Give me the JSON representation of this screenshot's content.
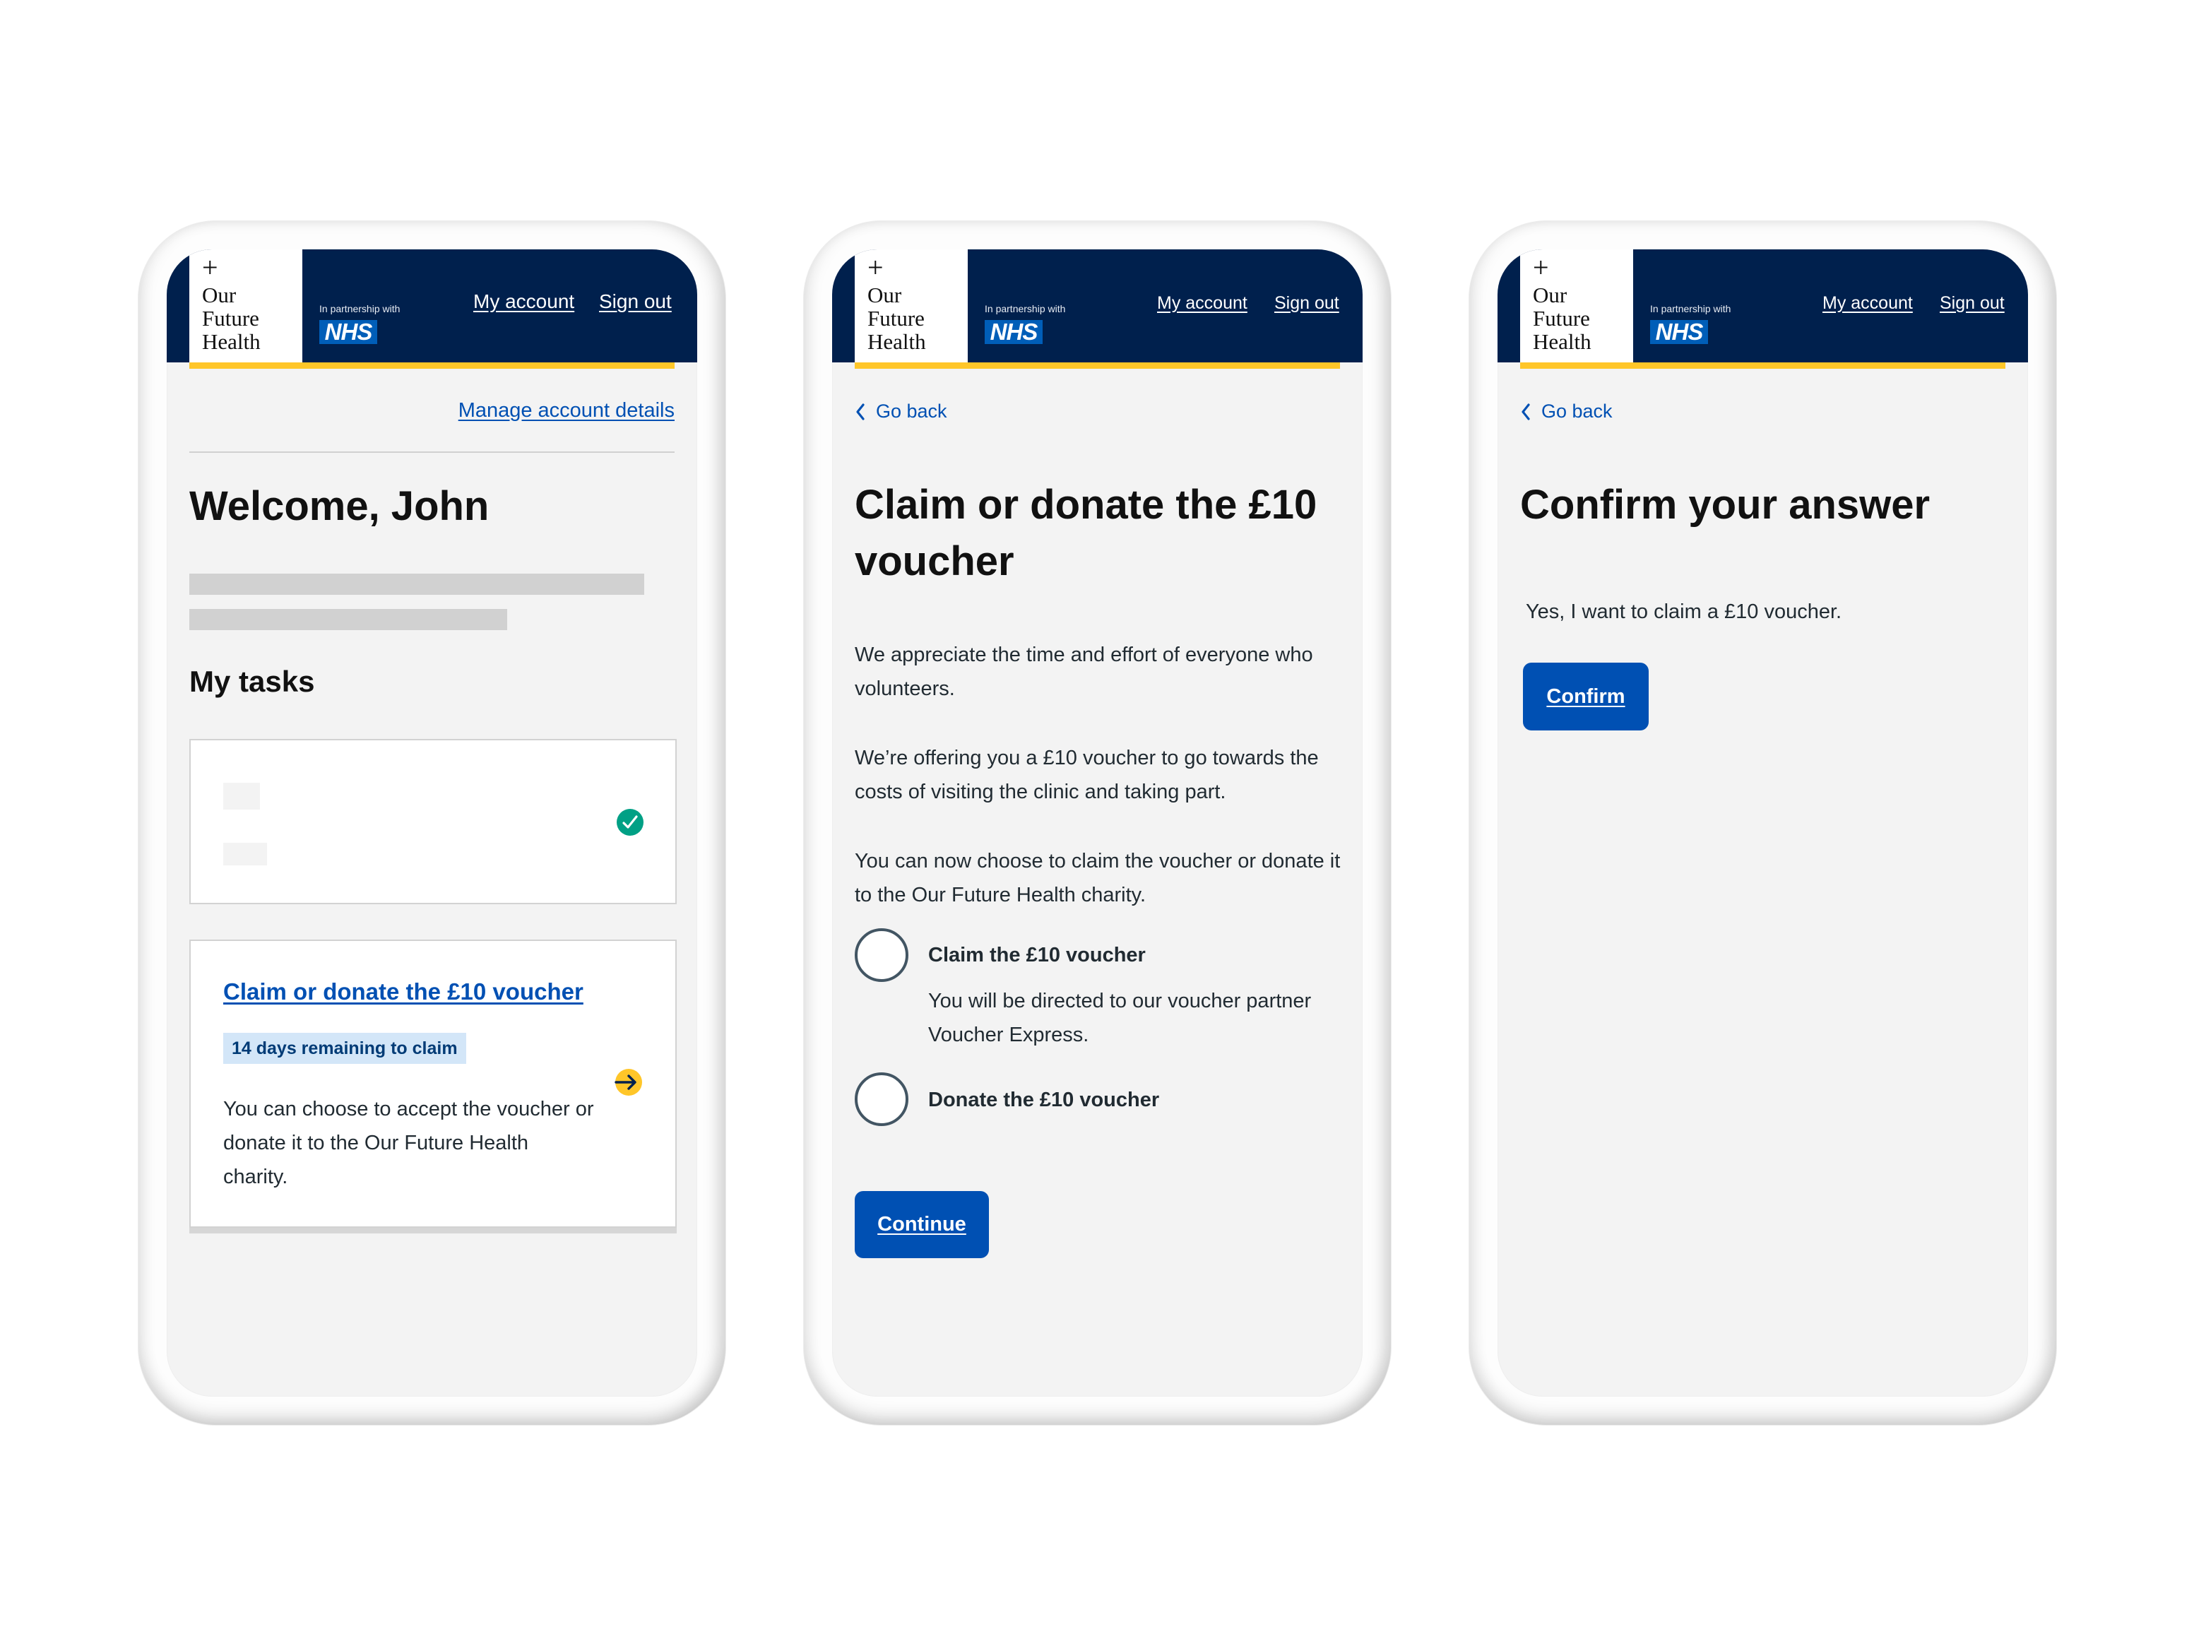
{
  "colors": {
    "header_bg": "#00204d",
    "accent_yellow": "#ffc629",
    "link_blue": "#0050b3",
    "button_blue": "#0050b3",
    "nhs_blue": "#005eb8",
    "success_green": "#00a085",
    "screen_bg": "#f3f3f3",
    "tag_bg": "#d3e6f8"
  },
  "header": {
    "logo_plus": "+",
    "logo_lines": [
      "Our",
      "Future",
      "Health"
    ],
    "partner_label": "In partnership with",
    "nhs_logo": "NHS",
    "nav": {
      "my_account": "My account",
      "sign_out": "Sign out"
    }
  },
  "screens": [
    {
      "id": "dashboard",
      "manage_account_link": "Manage account details",
      "title": "Welcome, John",
      "tasks_heading": "My tasks",
      "tasks": [
        {
          "status": "completed",
          "status_icon": "check-circle-icon",
          "content": "placeholder"
        },
        {
          "status": "to-do",
          "title_link": "Claim or donate the £10 voucher",
          "tag": "14 days remaining to claim",
          "description": "You can choose to accept the voucher or donate it to the Our Future Health charity.",
          "action_icon": "arrow-right-circle-icon"
        }
      ]
    },
    {
      "id": "claim-or-donate",
      "back_link": "Go back",
      "title": "Claim or donate the £10 voucher",
      "paragraphs": [
        "We appreciate the time and effort of everyone who volunteers.",
        "We’re offering you a £10 voucher to go towards the costs of visiting the clinic and taking part.",
        "You can now choose to claim the voucher or donate it to the Our Future Health charity."
      ],
      "options": [
        {
          "label": "Claim the £10 voucher",
          "hint": "You will be directed to our voucher partner Voucher Express.",
          "selected": false
        },
        {
          "label": "Donate the £10 voucher",
          "hint": "",
          "selected": false
        }
      ],
      "continue_button": "Continue"
    },
    {
      "id": "confirm-answer",
      "back_link": "Go back",
      "title": "Confirm your answer",
      "answer_text": "Yes, I want to claim a £10 voucher.",
      "confirm_button": "Confirm"
    }
  ]
}
